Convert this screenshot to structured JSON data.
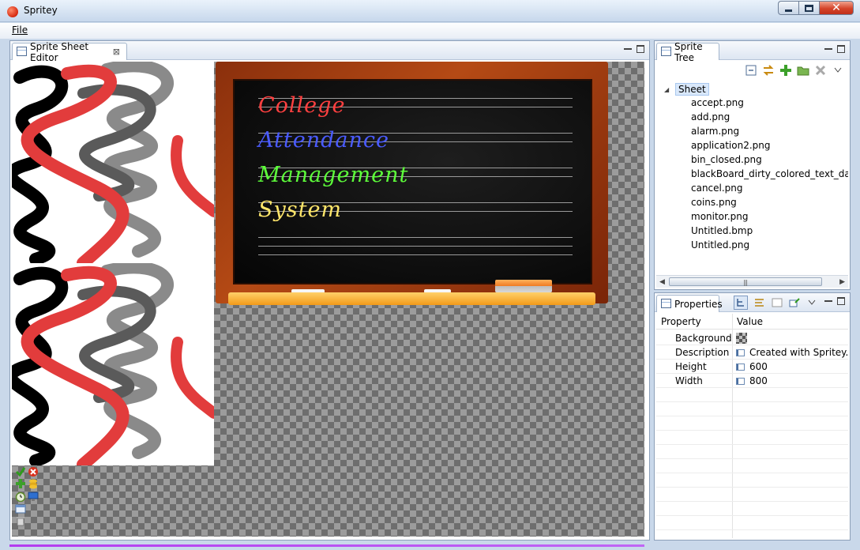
{
  "window": {
    "title": "Spritey"
  },
  "menu": {
    "file": "File"
  },
  "editor": {
    "tab_label": "Sprite Sheet Editor",
    "tab_close": "⊠",
    "blackboard": {
      "lines": [
        {
          "text": "College",
          "color": "#ff4040"
        },
        {
          "text": "Attendance",
          "color": "#4a5bff"
        },
        {
          "text": "Management",
          "color": "#5dff3a"
        },
        {
          "text": "System",
          "color": "#ffe66a"
        }
      ]
    }
  },
  "sprite_tree": {
    "tab_label": "Sprite Tree",
    "root": "Sheet",
    "items": [
      "accept.png",
      "add.png",
      "alarm.png",
      "application2.png",
      "bin_closed.png",
      "blackBoard_dirty_colored_text_darker.p",
      "cancel.png",
      "coins.png",
      "monitor.png",
      "Untitled.bmp",
      "Untitled.png"
    ],
    "scroll_grip": "|||"
  },
  "properties": {
    "tab_label": "Properties",
    "col_property": "Property",
    "col_value": "Value",
    "rows": [
      {
        "name": "Background",
        "value": ""
      },
      {
        "name": "Description",
        "value": "Created with Spritey."
      },
      {
        "name": "Height",
        "value": "600"
      },
      {
        "name": "Width",
        "value": "800"
      }
    ]
  },
  "colors": {
    "red_stroke": "#e23c3c",
    "gray_stroke": "#8a8a8a",
    "black_stroke": "#000000",
    "accent_border": "#8c9fb8"
  }
}
